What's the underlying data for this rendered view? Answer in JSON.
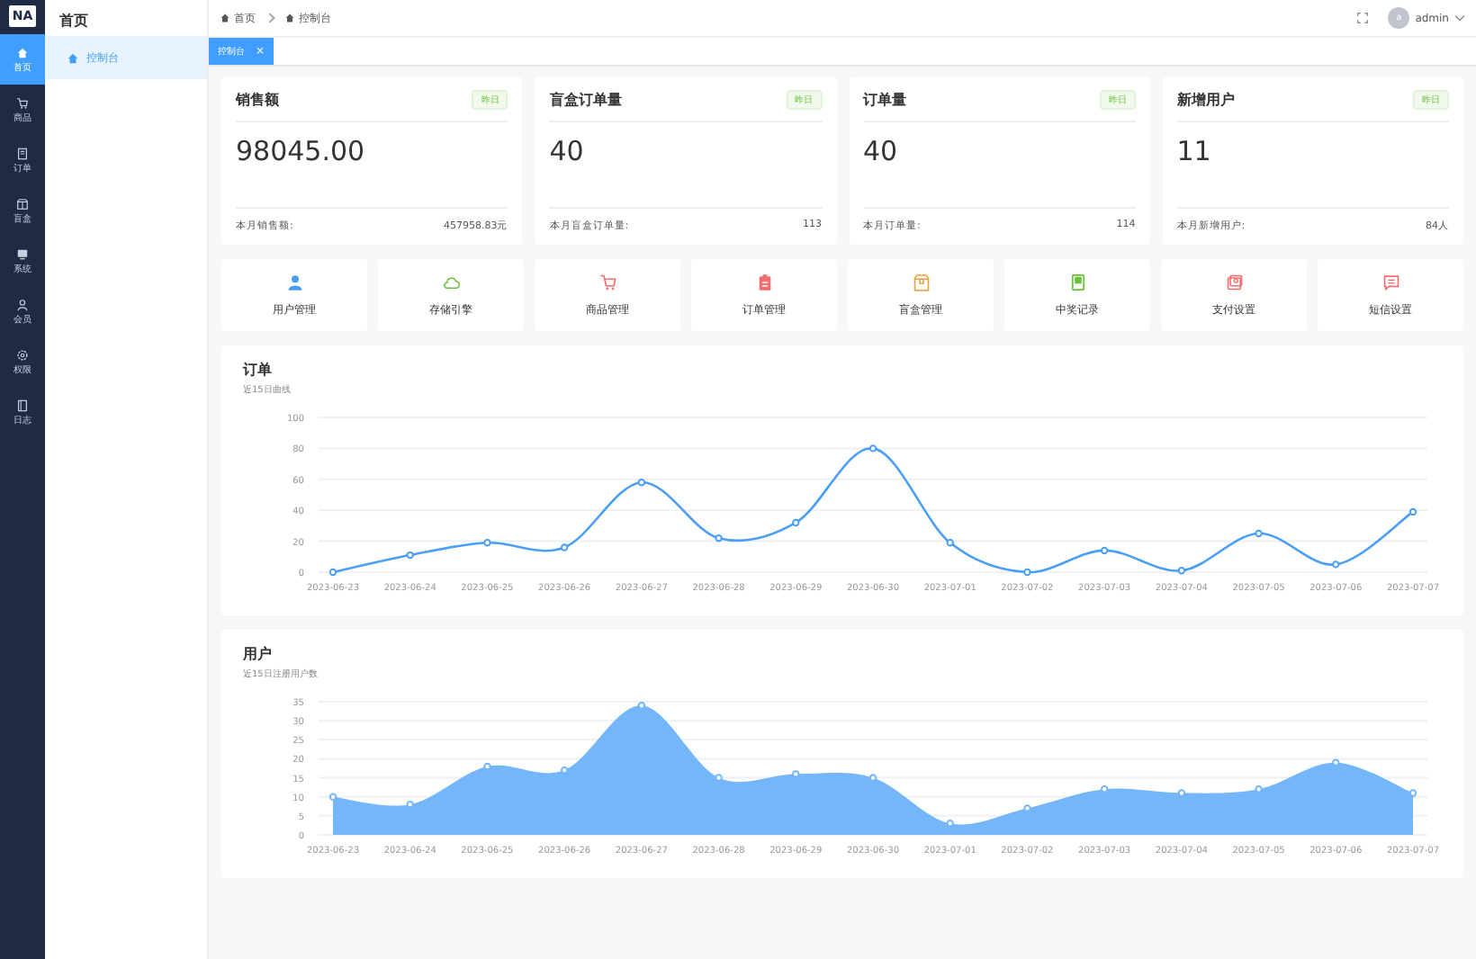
{
  "logo": "NA",
  "nav": [
    {
      "label": "首页",
      "kind": "home",
      "selected": true
    },
    {
      "label": "商品",
      "kind": "cart",
      "selected": false
    },
    {
      "label": "订单",
      "kind": "doc",
      "selected": false
    },
    {
      "label": "盲盒",
      "kind": "box",
      "selected": false
    },
    {
      "label": "系统",
      "kind": "monitor",
      "selected": false
    },
    {
      "label": "会员",
      "kind": "user",
      "selected": false
    },
    {
      "label": "权限",
      "kind": "gear",
      "selected": false
    },
    {
      "label": "日志",
      "kind": "book",
      "selected": false
    }
  ],
  "submenu": {
    "title": "首页",
    "items": [
      {
        "label": "控制台",
        "selected": true
      }
    ]
  },
  "breadcrumb": [
    "首页",
    "控制台"
  ],
  "user": {
    "avatar": "a",
    "name": "admin"
  },
  "tabs": [
    {
      "label": "控制台",
      "close": "×",
      "selected": true
    }
  ],
  "stats": [
    {
      "title": "销售额",
      "tag": "昨日",
      "value": "98045.00",
      "foot_label": "本月销售额:",
      "foot_value": "457958.83元"
    },
    {
      "title": "盲盒订单量",
      "tag": "昨日",
      "value": "40",
      "foot_label": "本月盲盒订单量:",
      "foot_value": "113"
    },
    {
      "title": "订单量",
      "tag": "昨日",
      "value": "40",
      "foot_label": "本月订单量:",
      "foot_value": "114"
    },
    {
      "title": "新增用户",
      "tag": "昨日",
      "value": "11",
      "foot_label": "本月新增用户:",
      "foot_value": "84人"
    }
  ],
  "shortcuts": [
    {
      "label": "用户管理",
      "kind": "user",
      "color": "#4a9ff5"
    },
    {
      "label": "存储引擎",
      "kind": "cloud",
      "color": "#67c23a"
    },
    {
      "label": "商品管理",
      "kind": "cart",
      "color": "#f56c6c"
    },
    {
      "label": "订单管理",
      "kind": "clipboard",
      "color": "#f56c6c"
    },
    {
      "label": "盲盒管理",
      "kind": "box",
      "color": "#e6a23c"
    },
    {
      "label": "中奖记录",
      "kind": "book",
      "color": "#67c23a"
    },
    {
      "label": "支付设置",
      "kind": "card",
      "color": "#f56c6c"
    },
    {
      "label": "短信设置",
      "kind": "message",
      "color": "#f56c6c"
    }
  ],
  "charts": [
    {
      "subtitle": "近15日曲线",
      "chart_data": {
        "type": "line",
        "title": "订单",
        "grid": true,
        "categories": [
          "2023-06-23",
          "2023-06-24",
          "2023-06-25",
          "2023-06-26",
          "2023-06-27",
          "2023-06-28",
          "2023-06-29",
          "2023-06-30",
          "2023-07-01",
          "2023-07-02",
          "2023-07-03",
          "2023-07-04",
          "2023-07-05",
          "2023-07-06",
          "2023-07-07"
        ],
        "series": [
          {
            "color": "#4a9ff5",
            "marker": true,
            "values": [
              0,
              11,
              19,
              16,
              58,
              22,
              32,
              80,
              19,
              0,
              14,
              1,
              25,
              5,
              39
            ]
          }
        ],
        "ylim": [
          0,
          100
        ],
        "yticks": [
          0,
          20,
          40,
          60,
          80,
          100
        ]
      }
    },
    {
      "subtitle": "近15日注册用户数",
      "chart_data": {
        "type": "area",
        "title": "用户",
        "grid": true,
        "categories": [
          "2023-06-23",
          "2023-06-24",
          "2023-06-25",
          "2023-06-26",
          "2023-06-27",
          "2023-06-28",
          "2023-06-29",
          "2023-06-30",
          "2023-07-01",
          "2023-07-02",
          "2023-07-03",
          "2023-07-04",
          "2023-07-05",
          "2023-07-06",
          "2023-07-07"
        ],
        "series": [
          {
            "color": "#74b6fa",
            "marker": true,
            "values": [
              10,
              8,
              18,
              17,
              34,
              15,
              16,
              15,
              3,
              7,
              12,
              11,
              12,
              19,
              11
            ]
          }
        ],
        "ylim": [
          0,
          35
        ],
        "yticks": [
          0,
          5,
          10,
          15,
          20,
          25,
          30,
          35
        ]
      }
    }
  ]
}
